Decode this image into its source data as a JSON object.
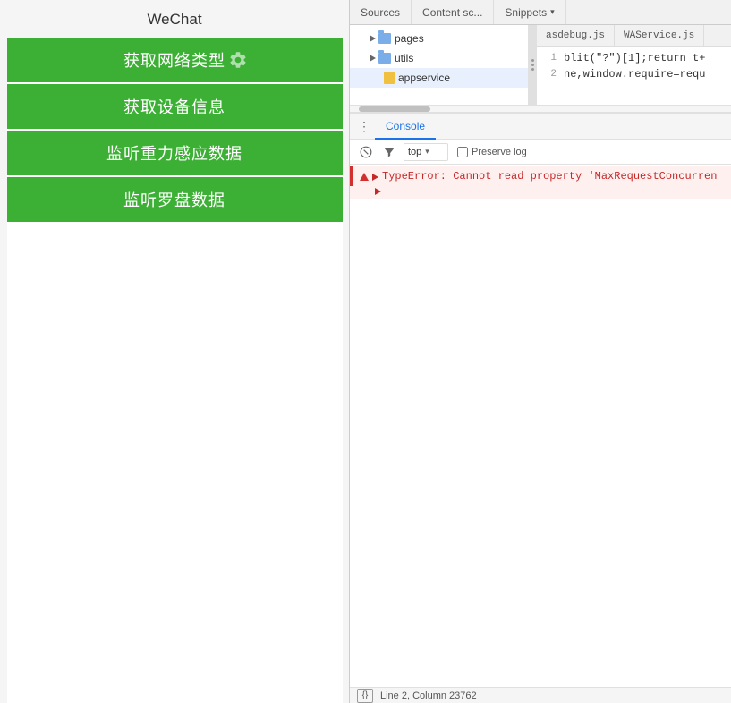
{
  "wechat": {
    "title": "WeChat",
    "buttons": [
      {
        "label": "获取网络类型",
        "id": "get-network-type"
      },
      {
        "label": "获取设备信息",
        "id": "get-device-info"
      },
      {
        "label": "监听重力感应数据",
        "id": "listen-gravity"
      },
      {
        "label": "监听罗盘数据",
        "id": "listen-compass"
      }
    ]
  },
  "devtools": {
    "sources_tabs": [
      {
        "label": "Sources",
        "active": false
      },
      {
        "label": "Content sc...",
        "active": false
      },
      {
        "label": "Snippets",
        "active": false
      }
    ],
    "file_tabs": [
      {
        "label": "asdebug.js",
        "active": false
      },
      {
        "label": "WAService.js",
        "active": false
      }
    ],
    "file_tree": {
      "items": [
        {
          "type": "folder",
          "label": "pages",
          "indent": 1,
          "open": false
        },
        {
          "type": "folder",
          "label": "utils",
          "indent": 1,
          "open": false
        },
        {
          "type": "file",
          "label": "appservice",
          "indent": 2,
          "selected": true
        }
      ]
    },
    "code_lines": [
      {
        "num": "1",
        "content": "blit(\"?\")[1];return t+"
      },
      {
        "num": "2",
        "content": "ne,window.require=requ"
      }
    ],
    "status_bar": {
      "braces_label": "{}",
      "line_col": "Line 2, Column 23762"
    },
    "console": {
      "tab_label": "Console",
      "toolbar": {
        "filter_placeholder": "Filter",
        "context_label": "top",
        "preserve_log_label": "Preserve log"
      },
      "messages": [
        {
          "type": "error",
          "text": "TypeError: Cannot read property 'MaxRequestConcurren",
          "has_continuation": true
        }
      ]
    }
  }
}
